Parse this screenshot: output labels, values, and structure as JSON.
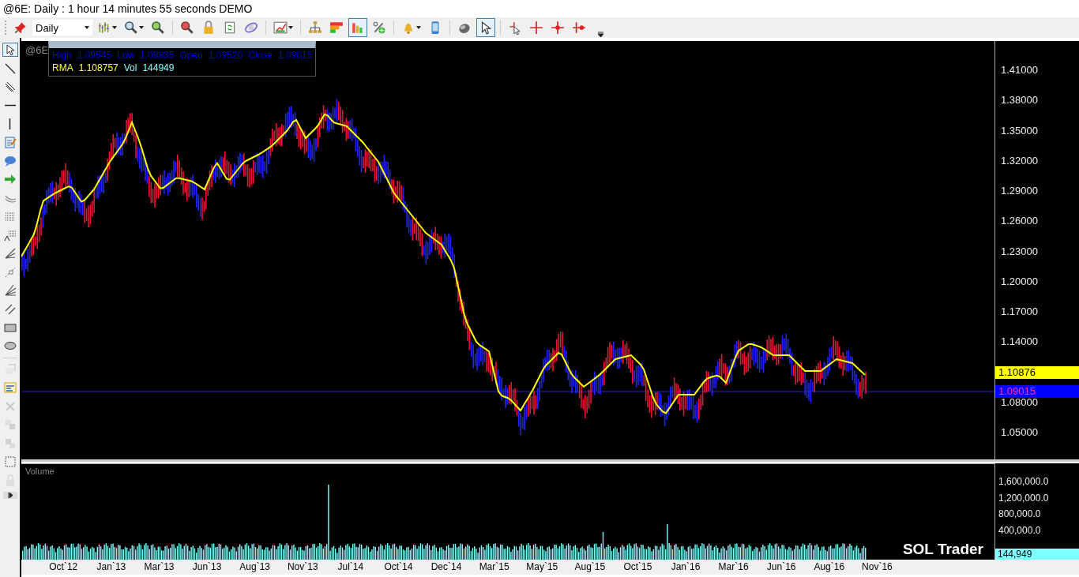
{
  "window": {
    "title": "@6E: Daily : 1 hour 14 minutes 55 seconds DEMO"
  },
  "toolbar": {
    "interval": "Daily",
    "tools": [
      {
        "kind": "pin",
        "dropdown": false,
        "selected": false
      },
      {
        "kind": "bars",
        "dropdown": true,
        "selected": false
      },
      {
        "kind": "zoom",
        "dropdown": true,
        "selected": false
      },
      {
        "kind": "zoom-in",
        "dropdown": false,
        "selected": false
      },
      {
        "kind": "zoom-out",
        "dropdown": false,
        "selected": false
      },
      {
        "kind": "lock",
        "dropdown": false,
        "selected": false
      },
      {
        "kind": "refresh",
        "dropdown": false,
        "selected": false
      },
      {
        "kind": "orbit",
        "dropdown": false,
        "selected": false
      },
      {
        "kind": "chart",
        "dropdown": true,
        "selected": false
      },
      {
        "kind": "hierarchy",
        "dropdown": false,
        "selected": false
      },
      {
        "kind": "heatmap",
        "dropdown": false,
        "selected": false
      },
      {
        "kind": "bar-chart",
        "dropdown": false,
        "selected": true
      },
      {
        "kind": "percent",
        "dropdown": false,
        "selected": false
      },
      {
        "kind": "bell",
        "dropdown": true,
        "selected": false
      },
      {
        "kind": "phone",
        "dropdown": false,
        "selected": false
      },
      {
        "kind": "mouse",
        "dropdown": false,
        "selected": false
      },
      {
        "kind": "pointer",
        "dropdown": false,
        "selected": true
      },
      {
        "kind": "cross-pointer",
        "dropdown": false,
        "selected": false
      },
      {
        "kind": "crosshair",
        "dropdown": false,
        "selected": false
      },
      {
        "kind": "cross-dot",
        "dropdown": false,
        "selected": false
      },
      {
        "kind": "cross-right",
        "dropdown": false,
        "selected": false
      }
    ]
  },
  "drawing_tools": [
    {
      "kind": "pointer",
      "selected": true,
      "disabled": false
    },
    {
      "kind": "line",
      "selected": false,
      "disabled": false
    },
    {
      "kind": "parallel",
      "selected": false,
      "disabled": false
    },
    {
      "kind": "hline",
      "selected": false,
      "disabled": false
    },
    {
      "kind": "vline",
      "selected": false,
      "disabled": false
    },
    {
      "kind": "note",
      "selected": false,
      "disabled": false
    },
    {
      "kind": "callout",
      "selected": false,
      "disabled": false
    },
    {
      "kind": "arrow",
      "selected": false,
      "disabled": false
    },
    {
      "kind": "arc",
      "selected": false,
      "disabled": false
    },
    {
      "kind": "dotgrid",
      "selected": false,
      "disabled": false
    },
    {
      "kind": "fibtext",
      "selected": false,
      "disabled": false
    },
    {
      "kind": "fan",
      "selected": false,
      "disabled": false
    },
    {
      "kind": "gann",
      "selected": false,
      "disabled": false
    },
    {
      "kind": "fan2",
      "selected": false,
      "disabled": false
    },
    {
      "kind": "channel",
      "selected": false,
      "disabled": false
    },
    {
      "kind": "rectangle",
      "selected": false,
      "disabled": false
    },
    {
      "kind": "ellipse",
      "selected": false,
      "disabled": false
    },
    {
      "kind": "layers",
      "selected": false,
      "disabled": true
    },
    {
      "kind": "properties",
      "selected": false,
      "disabled": false
    },
    {
      "kind": "delete",
      "selected": false,
      "disabled": true
    },
    {
      "kind": "front",
      "selected": false,
      "disabled": true
    },
    {
      "kind": "back",
      "selected": false,
      "disabled": true
    },
    {
      "kind": "select",
      "selected": false,
      "disabled": false
    },
    {
      "kind": "lock",
      "selected": false,
      "disabled": true
    }
  ],
  "chart": {
    "symbol": "@6E",
    "info": [
      [
        {
          "text": "High",
          "color": "#0000cc"
        },
        {
          "text": "1.09545",
          "color": "#0000cc"
        },
        {
          "text": "Low",
          "color": "#0000cc"
        },
        {
          "text": "1.08835",
          "color": "#0000cc"
        },
        {
          "text": "Open",
          "color": "#0000cc"
        },
        {
          "text": "1.09520",
          "color": "#0000cc"
        },
        {
          "text": "Close",
          "color": "#0000cc"
        },
        {
          "text": "1.09015",
          "color": "#0000cc"
        }
      ],
      [
        {
          "text": "RMA",
          "color": "#ffff33"
        },
        {
          "text": "1.108757",
          "color": "#ffff33"
        },
        {
          "text": "Vol",
          "color": "#80ffff"
        },
        {
          "text": "144949",
          "color": "#80ffff"
        }
      ]
    ],
    "price_ticks": [
      "1.41000",
      "1.38000",
      "1.35000",
      "1.32000",
      "1.29000",
      "1.26000",
      "1.23000",
      "1.20000",
      "1.17000",
      "1.14000",
      "1.08000",
      "1.05000"
    ],
    "tags": [
      {
        "kind": "indicator",
        "text": "1.10876"
      },
      {
        "kind": "last",
        "text": "1.09015"
      }
    ]
  },
  "volume": {
    "title": "Volume",
    "ticks": [
      "1,600,000.0",
      "1,200,000.0",
      "800,000.0",
      "400,000.0"
    ],
    "tag": "144,949",
    "brand": "SOL Trader"
  },
  "time_axis": [
    "Oct`12",
    "Jan`13",
    "Mar`13",
    "Jun`13",
    "Aug`13",
    "Nov`13",
    "Jul`14",
    "Oct`14",
    "Dec`14",
    "Mar`15",
    "May`15",
    "Aug`15",
    "Oct`15",
    "Jan`16",
    "Mar`16",
    "Jun`16",
    "Aug`16",
    "Nov`16"
  ]
}
